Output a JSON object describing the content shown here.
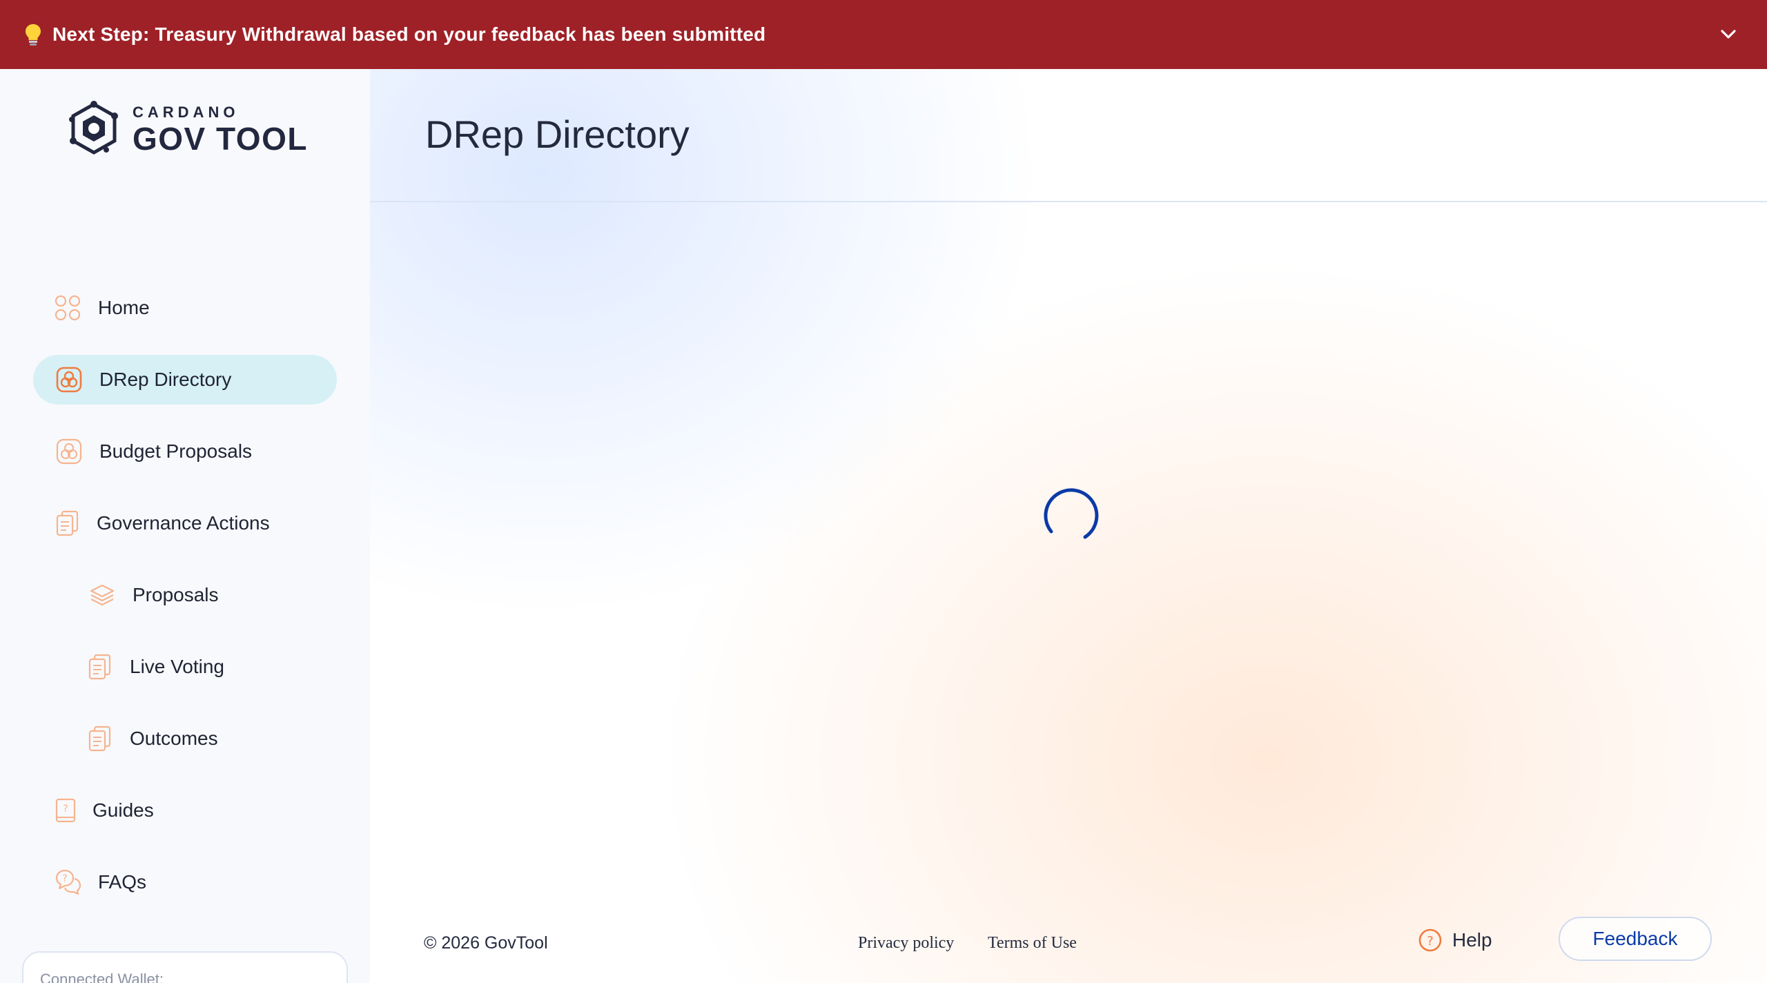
{
  "banner": {
    "message": "Next Step: Treasury Withdrawal based on your feedback has been submitted",
    "background": "#9e2127",
    "icon": "lightbulb-icon",
    "toggle_icon": "chevron-down-icon"
  },
  "logo": {
    "line1": "CARDANO",
    "line2": "GOV TOOL"
  },
  "sidebar": {
    "items": [
      {
        "label": "Home",
        "icon": "grid-icon",
        "active": false
      },
      {
        "label": "DRep Directory",
        "icon": "drep-icon",
        "active": true
      },
      {
        "label": "Budget Proposals",
        "icon": "budget-icon",
        "active": false
      },
      {
        "label": "Governance Actions",
        "icon": "documents-icon",
        "active": false
      },
      {
        "label": "Proposals",
        "icon": "layers-icon",
        "active": false
      },
      {
        "label": "Live Voting",
        "icon": "documents-icon",
        "active": false
      },
      {
        "label": "Outcomes",
        "icon": "documents-icon",
        "active": false
      },
      {
        "label": "Guides",
        "icon": "guide-book-icon",
        "active": false
      },
      {
        "label": "FAQs",
        "icon": "faq-bubbles-icon",
        "active": false
      }
    ],
    "wallet_label": "Connected Wallet:"
  },
  "main": {
    "title": "DRep Directory",
    "loading": true
  },
  "footer": {
    "copyright": "© 2026 GovTool",
    "privacy": "Privacy policy",
    "terms": "Terms of Use",
    "help": "Help",
    "feedback": "Feedback"
  },
  "colors": {
    "accent_orange": "#f07b3f",
    "active_bg": "#d6f0f6",
    "primary_blue": "#0b3aa8"
  }
}
